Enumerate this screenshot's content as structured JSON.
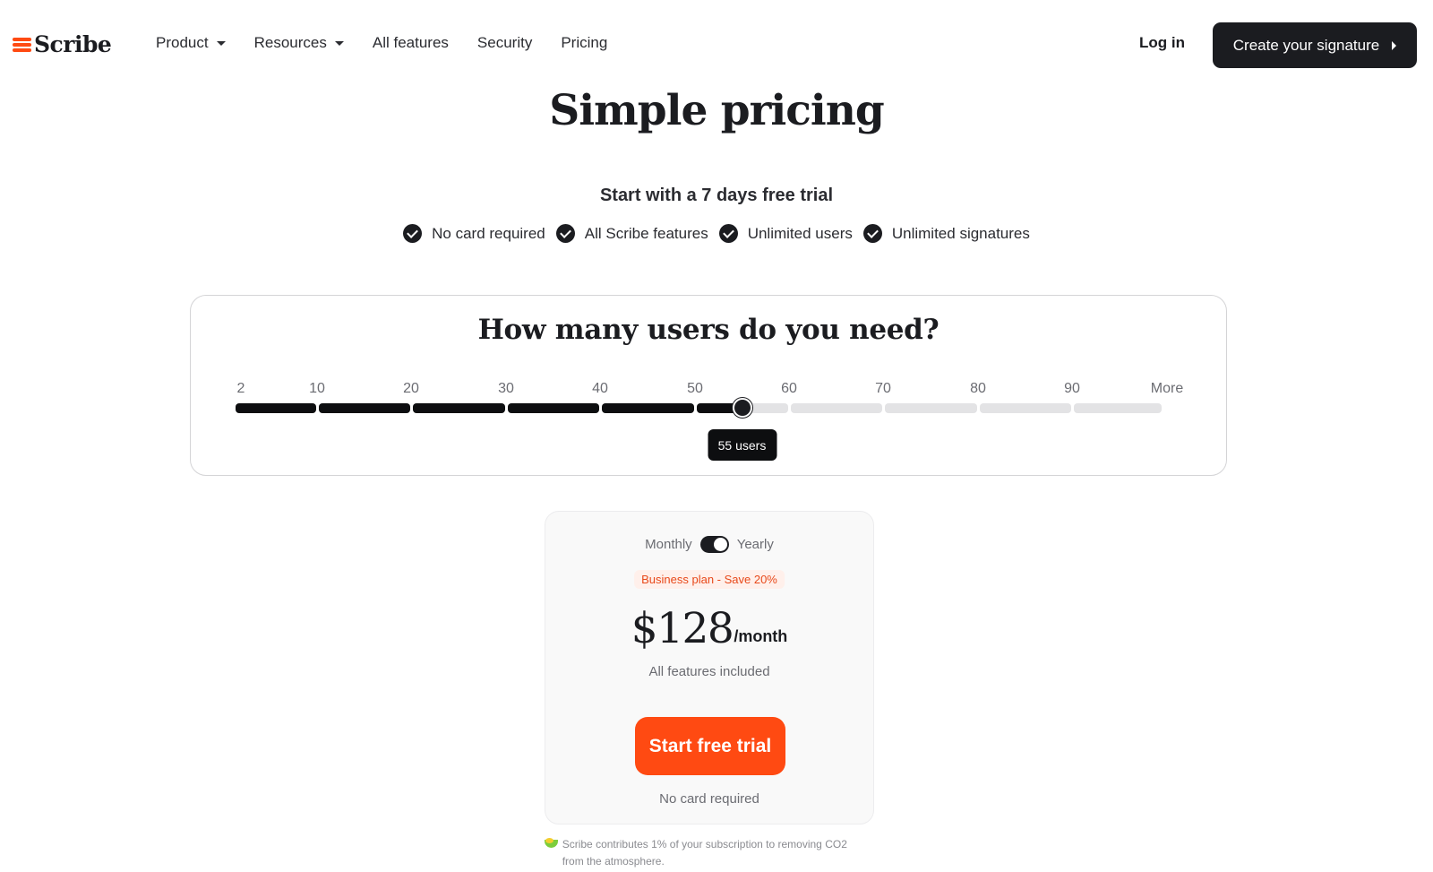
{
  "header": {
    "logo_text": "Scribe",
    "nav": [
      {
        "label": "Product",
        "has_dropdown": true
      },
      {
        "label": "Resources",
        "has_dropdown": true
      },
      {
        "label": "All features",
        "has_dropdown": false
      },
      {
        "label": "Security",
        "has_dropdown": false
      },
      {
        "label": "Pricing",
        "has_dropdown": false
      }
    ],
    "login_label": "Log in",
    "cta_label": "Create your signature"
  },
  "hero": {
    "title": "Simple pricing",
    "subtitle": "Start with a 7 days free trial",
    "perks": [
      "No card required",
      "All Scribe features",
      "Unlimited users",
      "Unlimited signatures"
    ]
  },
  "users_selector": {
    "title": "How many users do you need?",
    "ticks": [
      "2",
      "10",
      "20",
      "30",
      "40",
      "50",
      "60",
      "70",
      "80",
      "90",
      "More"
    ],
    "selected_users": 55,
    "tooltip": "55 users"
  },
  "plan": {
    "billing_left": "Monthly",
    "billing_right": "Yearly",
    "billing_selected": "Yearly",
    "badge": "Business plan - Save 20%",
    "price": "$128",
    "period": "/month",
    "features_note": "All features included",
    "cta_label": "Start free trial",
    "no_card": "No card required"
  },
  "footnote": {
    "text": "Scribe contributes 1% of your subscription to removing CO2 from the atmosphere."
  },
  "colors": {
    "brand_orange": "#ff4a12",
    "dark": "#1b1c20",
    "track_off": "#e3e3e5",
    "badge_bg": "#fff0eb"
  }
}
